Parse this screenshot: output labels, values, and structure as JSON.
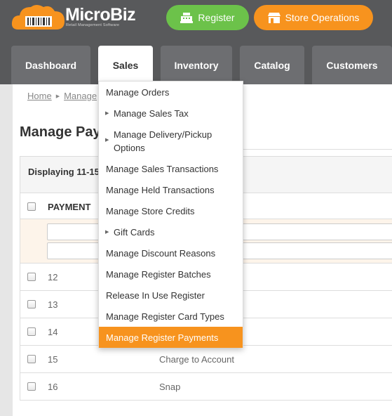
{
  "brand": {
    "name": "MicroBiz",
    "tagline": "Retail Management Software"
  },
  "header_buttons": {
    "register": "Register",
    "store_operations": "Store Operations"
  },
  "tabs": [
    {
      "label": "Dashboard",
      "active": false
    },
    {
      "label": "Sales",
      "active": true
    },
    {
      "label": "Inventory",
      "active": false
    },
    {
      "label": "Catalog",
      "active": false
    },
    {
      "label": "Customers",
      "active": false
    }
  ],
  "breadcrumb": [
    "Home",
    "Manage"
  ],
  "page_title": "Manage Pay",
  "table": {
    "displaying": "Displaying 11-15",
    "column_payment": "PAYMENT",
    "rows": [
      {
        "id": "12",
        "name": ""
      },
      {
        "id": "13",
        "name": ""
      },
      {
        "id": "14",
        "name": ""
      },
      {
        "id": "15",
        "name": "Charge to Account"
      },
      {
        "id": "16",
        "name": "Snap"
      }
    ]
  },
  "sales_menu": [
    {
      "label": "Manage Orders",
      "submenu": false
    },
    {
      "label": "Manage Sales Tax",
      "submenu": true
    },
    {
      "label": "Manage Delivery/Pickup Options",
      "submenu": true
    },
    {
      "label": "Manage Sales Transactions",
      "submenu": false
    },
    {
      "label": "Manage Held Transactions",
      "submenu": false
    },
    {
      "label": "Manage Store Credits",
      "submenu": false
    },
    {
      "label": "Gift Cards",
      "submenu": true
    },
    {
      "label": "Manage Discount Reasons",
      "submenu": false
    },
    {
      "label": "Manage Register Batches",
      "submenu": false
    },
    {
      "label": "Release In Use Register",
      "submenu": false
    },
    {
      "label": "Manage Register Card Types",
      "submenu": false
    },
    {
      "label": "Manage Register Payments",
      "submenu": false,
      "highlighted": true
    }
  ],
  "colors": {
    "header": "#58595b",
    "tab": "#6d6e71",
    "green": "#6cc24a",
    "orange": "#f7931e"
  }
}
